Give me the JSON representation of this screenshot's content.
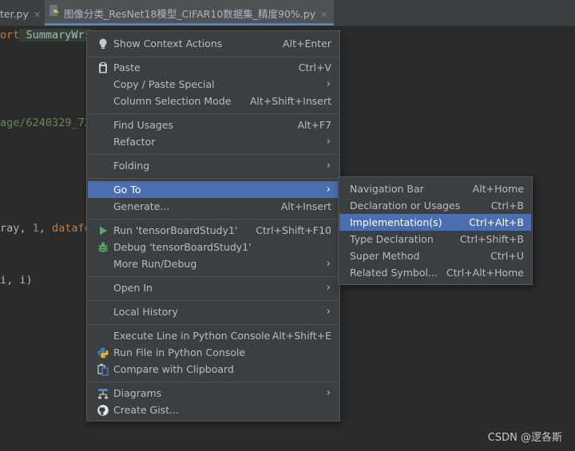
{
  "tabs": [
    {
      "label": "ter.py"
    },
    {
      "label": "图像分类_ResNet18模型_CIFAR10数据集_精度90%.py"
    }
  ],
  "code": {
    "line1_kw": "ort",
    "line1_cls": " SummaryWri",
    "line2_str": "age/6240329_72",
    "line3_a": "ray, ",
    "line3_num": "1",
    "line3_b": ", ",
    "line3_kw": "datafo",
    "line4": "i, i)"
  },
  "context_menu": {
    "items": [
      {
        "label": "Show Context Actions",
        "shortcut": "Alt+Enter",
        "icon": "lightbulb-icon"
      },
      {
        "label": "Paste",
        "shortcut": "Ctrl+V",
        "icon": "clipboard-icon"
      },
      {
        "label": "Copy / Paste Special",
        "submenu": true
      },
      {
        "label": "Column Selection Mode",
        "shortcut": "Alt+Shift+Insert"
      },
      {
        "label": "Find Usages",
        "shortcut": "Alt+F7"
      },
      {
        "label": "Refactor",
        "submenu": true
      },
      {
        "label": "Folding",
        "submenu": true
      },
      {
        "label": "Go To",
        "submenu": true,
        "selected": true
      },
      {
        "label": "Generate...",
        "shortcut": "Alt+Insert"
      },
      {
        "label": "Run 'tensorBoardStudy1'",
        "shortcut": "Ctrl+Shift+F10",
        "icon": "run-icon"
      },
      {
        "label": "Debug 'tensorBoardStudy1'",
        "icon": "debug-icon"
      },
      {
        "label": "More Run/Debug",
        "submenu": true
      },
      {
        "label": "Open In",
        "submenu": true
      },
      {
        "label": "Local History",
        "submenu": true
      },
      {
        "label": "Execute Line in Python Console",
        "shortcut": "Alt+Shift+E"
      },
      {
        "label": "Run File in Python Console",
        "icon": "python-icon"
      },
      {
        "label": "Compare with Clipboard",
        "icon": "compare-icon"
      },
      {
        "label": "Diagrams",
        "submenu": true,
        "icon": "diagram-icon"
      },
      {
        "label": "Create Gist...",
        "icon": "github-icon"
      }
    ],
    "submenu_arrow": "›"
  },
  "goto_submenu": {
    "items": [
      {
        "label": "Navigation Bar",
        "shortcut": "Alt+Home"
      },
      {
        "label": "Declaration or Usages",
        "shortcut": "Ctrl+B"
      },
      {
        "label": "Implementation(s)",
        "shortcut": "Ctrl+Alt+B",
        "selected": true
      },
      {
        "label": "Type Declaration",
        "shortcut": "Ctrl+Shift+B"
      },
      {
        "label": "Super Method",
        "shortcut": "Ctrl+U"
      },
      {
        "label": "Related Symbol...",
        "shortcut": "Ctrl+Alt+Home"
      }
    ]
  },
  "watermark": "CSDN @逻各斯",
  "colors": {
    "selection": "#4b6eaf",
    "menu_bg": "#3c3f41",
    "editor_bg": "#2b2b2b"
  }
}
